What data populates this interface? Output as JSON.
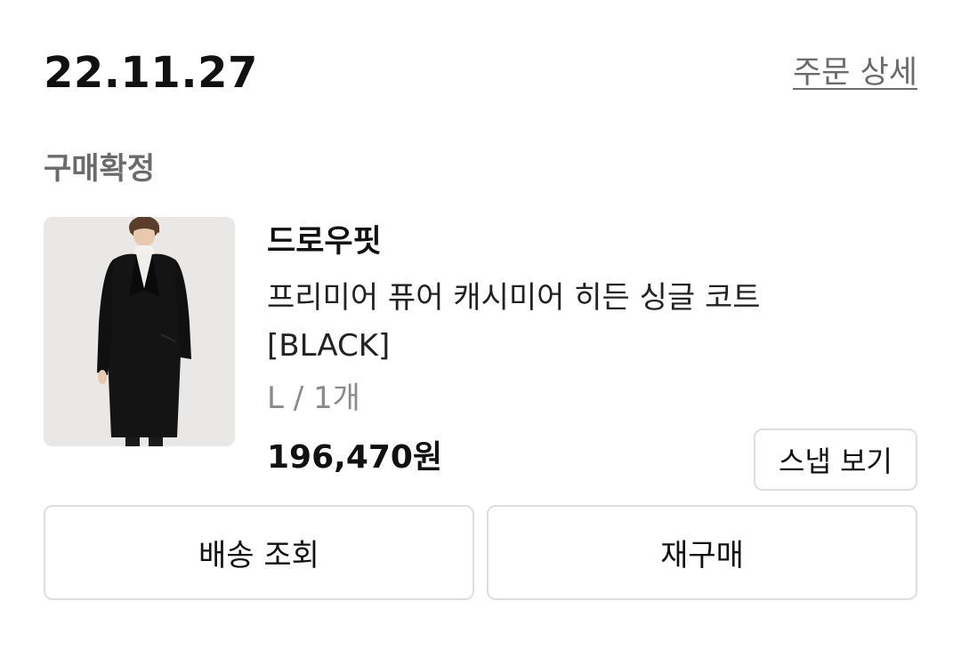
{
  "order": {
    "date": "22.11.27",
    "detail_link": "주문 상세",
    "status": "구매확정"
  },
  "product": {
    "image_icon": "coat-model-photo",
    "brand": "드로우핏",
    "name": "프리미어 퓨어 캐시미어 히든 싱글 코트 [BLACK]",
    "option": "L / 1개",
    "price": "196,470원"
  },
  "actions": {
    "snap_label": "스냅 보기",
    "delivery_label": "배송 조회",
    "rebuy_label": "재구매"
  },
  "colors": {
    "text_primary": "#111111",
    "text_secondary": "#6b6b6b",
    "border": "#dedede"
  }
}
